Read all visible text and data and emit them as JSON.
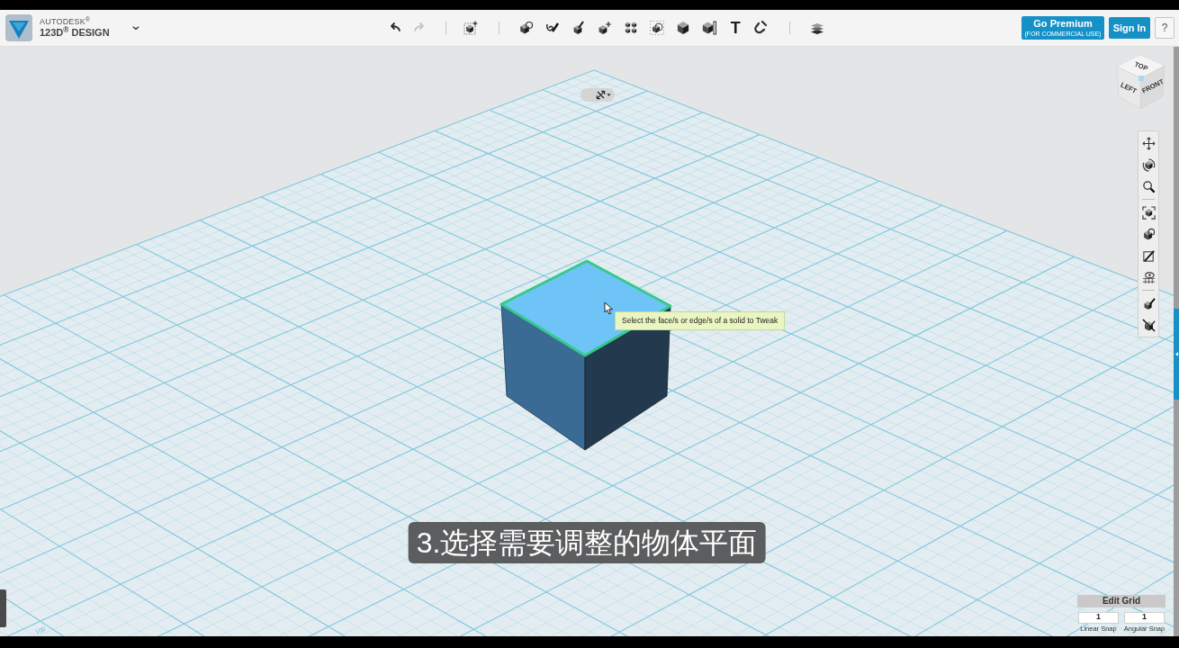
{
  "header": {
    "brand": {
      "company": "AUTODESK$^{®}$",
      "product": "123D$^{®}$ DESIGN"
    },
    "history": [
      {
        "kind": "undo",
        "disabled": false
      },
      {
        "kind": "redo",
        "disabled": true
      }
    ],
    "text_tool": "T",
    "premium_button": {
      "title": "Go Premium",
      "subtitle": "(FOR COMMERCIAL USE)"
    },
    "sign_in": "Sign In",
    "help": "?"
  },
  "viewport": {
    "view_cube": [
      "TOP",
      "LEFT",
      "FRONT"
    ],
    "tooltip": "Select the face/s or edge/s of a solid to Tweak",
    "grid_label": "100",
    "edit_grid": {
      "title": "Edit Grid",
      "fields": [
        {
          "value": "1",
          "label": "Linear Snap"
        },
        {
          "value": "1",
          "label": "Angular Snap"
        }
      ]
    },
    "subtitle": "3.选择需要调整的物体平面"
  }
}
